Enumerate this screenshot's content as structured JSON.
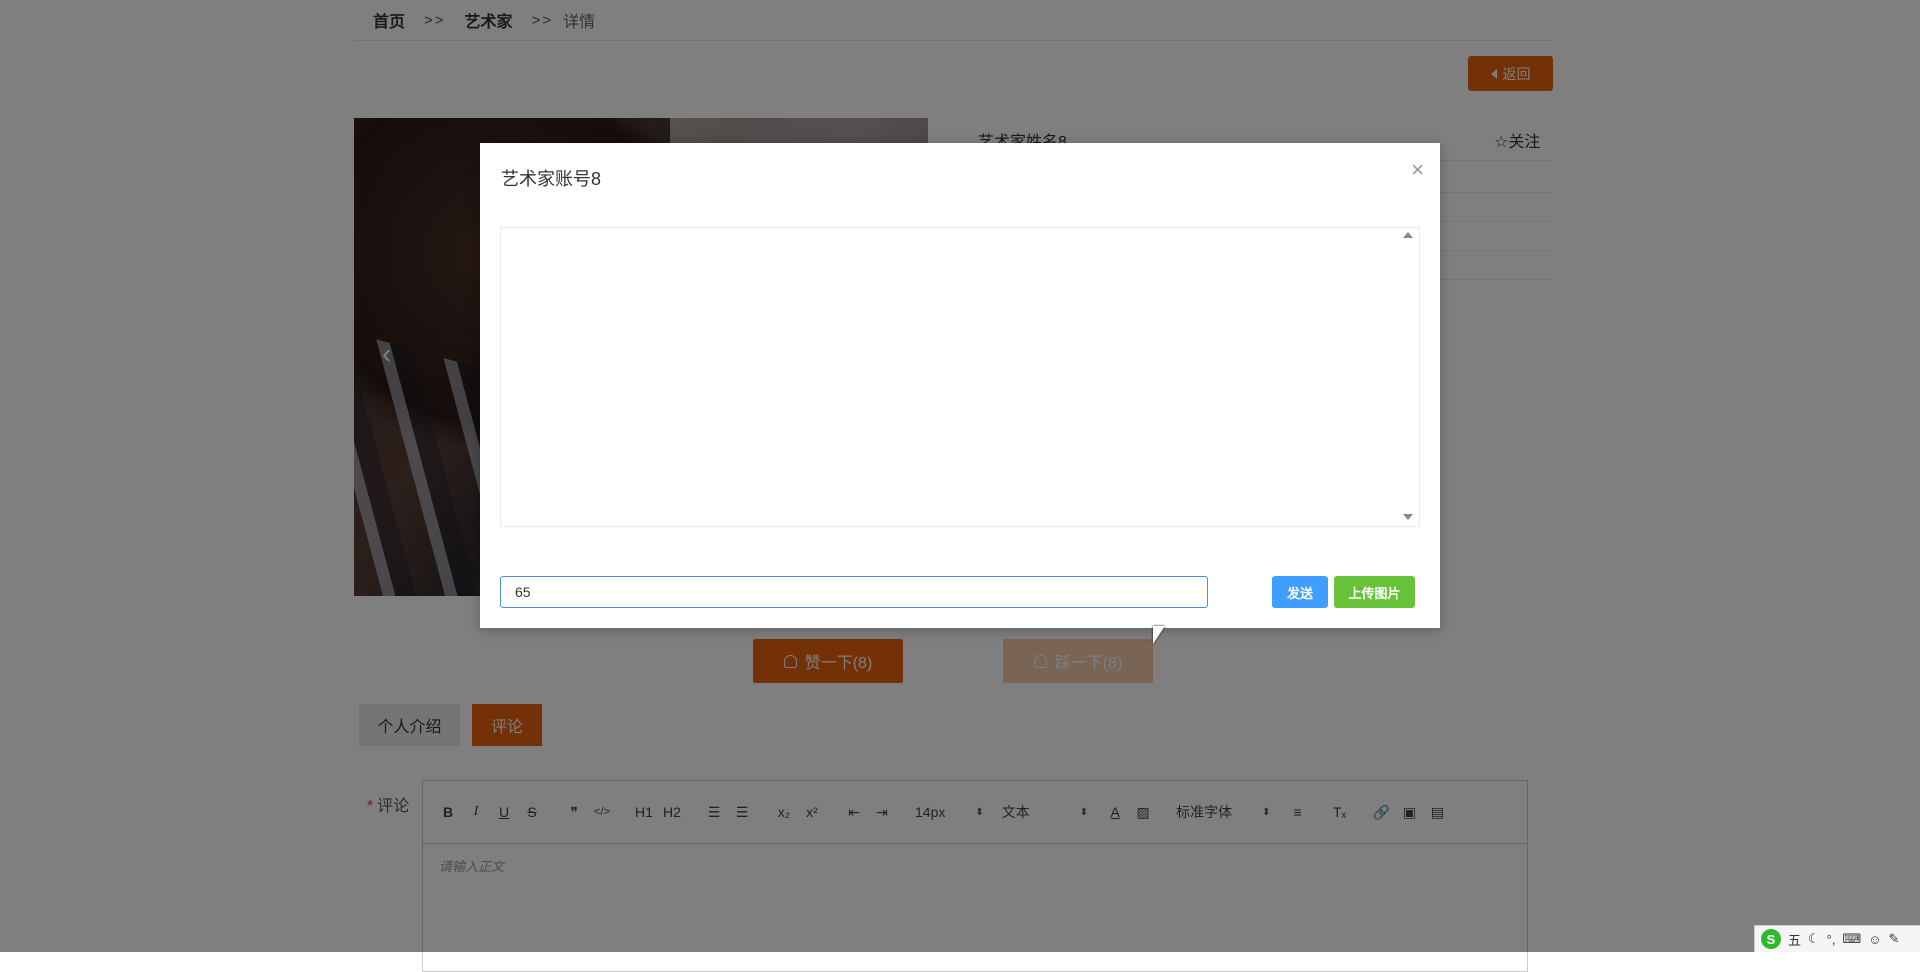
{
  "breadcrumb": {
    "home": "首页",
    "sep1": ">>",
    "artist": "艺术家",
    "sep2": ">>",
    "current": "详情"
  },
  "back_button": {
    "label": "返回"
  },
  "artist": {
    "name": "艺术家姓名8",
    "follow_label": "☆关注"
  },
  "photo": {
    "prev_arrow": "‹"
  },
  "like": {
    "like_label": "赞一下(8)",
    "dislike_label": "踩一下(8)"
  },
  "tabs": [
    {
      "label": "个人介绍",
      "active": false
    },
    {
      "label": "评论",
      "active": true
    }
  ],
  "comment": {
    "label": "评论",
    "required_mark": "*",
    "toolbar": {
      "font_size": "14px",
      "block_type": "文本",
      "font_family": "标准字体",
      "h1": "H1",
      "h2": "H2",
      "bold": "B",
      "italic": "I",
      "underline": "U",
      "strike": "S"
    },
    "placeholder": "请输入正文"
  },
  "modal": {
    "title": "艺术家账号8",
    "close": "×",
    "input_value": "65",
    "send_label": "发送",
    "upload_label": "上传图片"
  },
  "ime": {
    "logo": "S",
    "mode": "五"
  },
  "colors": {
    "accent": "#e8600e",
    "send": "#409eff",
    "upload": "#67c23a",
    "input_border": "#4a90d9"
  }
}
